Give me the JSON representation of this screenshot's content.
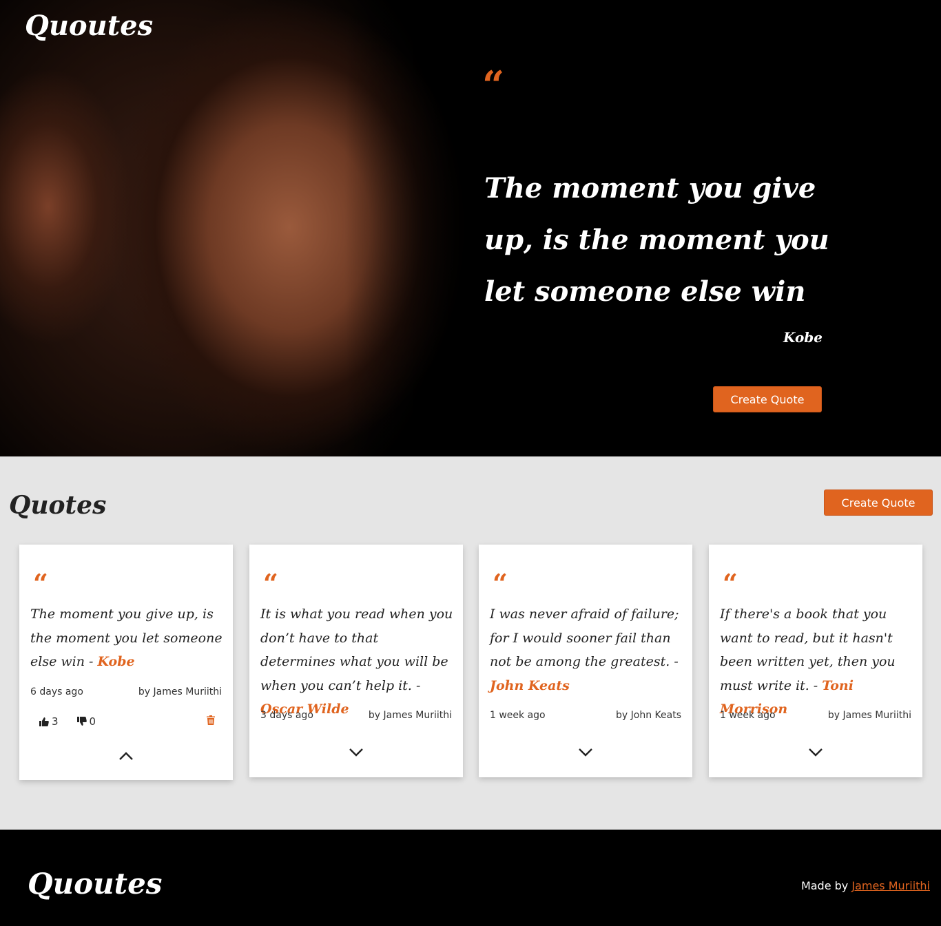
{
  "brand": "Quoutes",
  "hero": {
    "quote_mark": "“",
    "quote": "The moment you give up, is the moment you let someone else win",
    "author": "Kobe",
    "button": "Create Quote"
  },
  "quotes_section": {
    "title": "Quotes",
    "button": "Create Quote"
  },
  "cards": [
    {
      "quote_mark": "“",
      "text": "The moment you give up, is the moment you let someone else win - ",
      "author": "Kobe",
      "time": "6 days ago",
      "by": "by James Muriithi",
      "likes": "3",
      "dislikes": "0",
      "expanded": true
    },
    {
      "quote_mark": "“",
      "text": "It is what you read when you don’t have to that determines what you will be when you can’t help it. - ",
      "author": "Oscar Wilde",
      "time": "3 days ago",
      "by": "by James Muriithi",
      "expanded": false
    },
    {
      "quote_mark": "“",
      "text": "I was never afraid of failure; for I would sooner fail than not be among the greatest. - ",
      "author": "John Keats",
      "time": "1 week ago",
      "by": "by John Keats",
      "expanded": false
    },
    {
      "quote_mark": "“",
      "text": "If there's a book that you want to read, but it hasn't been written yet, then you must write it. - ",
      "author": "Toni Morrison",
      "time": "1 week ago",
      "by": "by James Muriithi",
      "expanded": false
    }
  ],
  "footer": {
    "brand": "Quoutes",
    "made_by_prefix": "Made by ",
    "made_by_link": "James Muriithi"
  },
  "colors": {
    "accent": "#e0641f",
    "hero_bg": "#000000",
    "section_bg": "#e5e5e5",
    "card_bg": "#ffffff"
  },
  "icons": {
    "like": "thumbs-up-icon",
    "dislike": "thumbs-down-icon",
    "delete": "trash-icon",
    "collapse": "chevron-up-icon",
    "expand": "chevron-down-icon"
  }
}
